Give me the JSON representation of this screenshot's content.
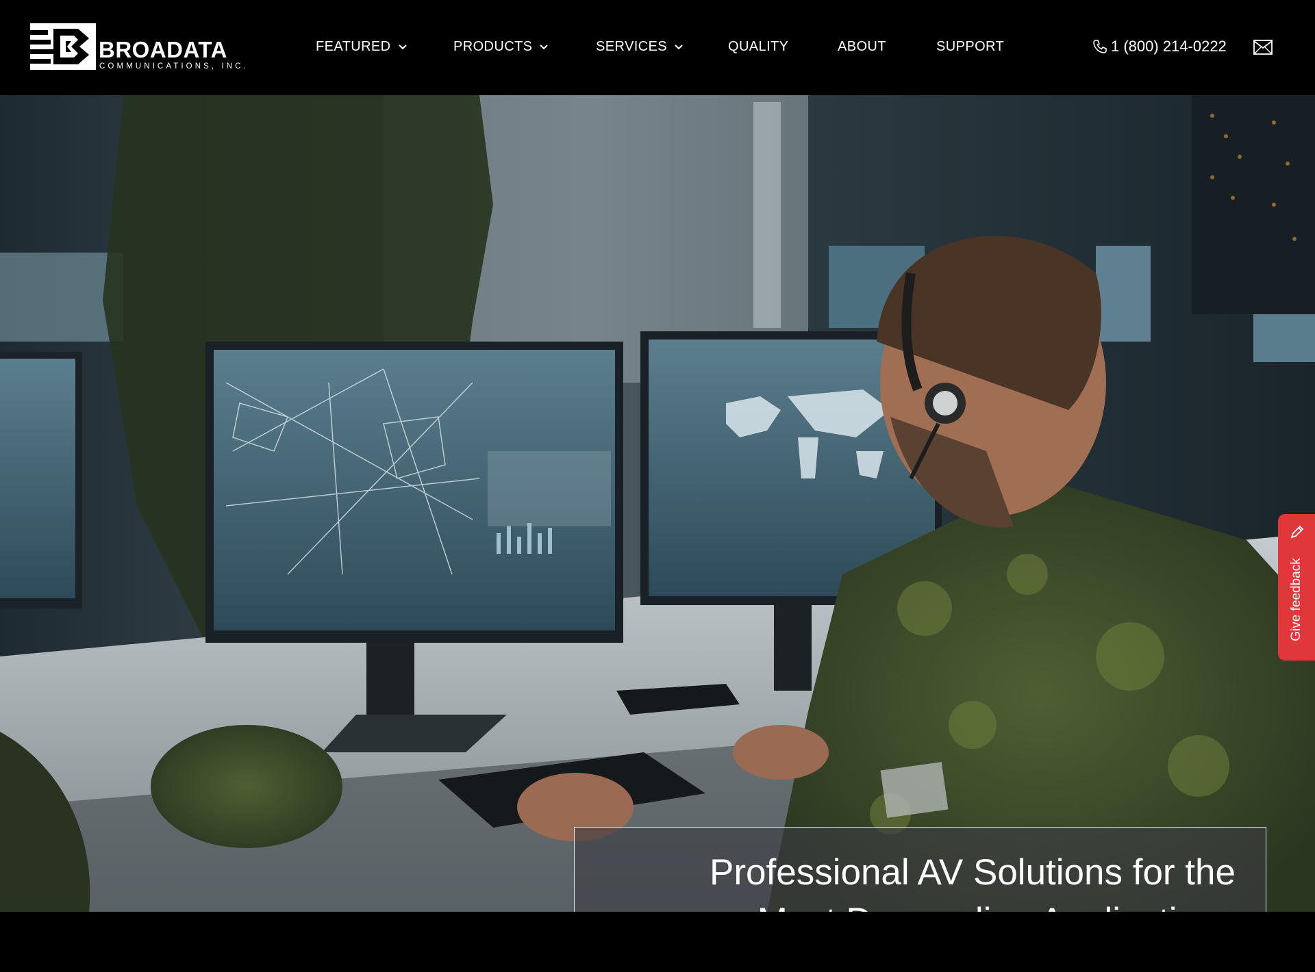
{
  "brand": {
    "name": "BROADATA",
    "subtitle": "COMMUNICATIONS, INC."
  },
  "nav": {
    "items": [
      {
        "label": "FEATURED",
        "has_dropdown": true
      },
      {
        "label": "PRODUCTS",
        "has_dropdown": true
      },
      {
        "label": "SERVICES",
        "has_dropdown": true
      },
      {
        "label": "QUALITY",
        "has_dropdown": false
      },
      {
        "label": "ABOUT",
        "has_dropdown": false
      },
      {
        "label": "SUPPORT",
        "has_dropdown": false
      }
    ]
  },
  "contact": {
    "phone": "1 (800) 214-0222",
    "phone_icon": "phone-icon",
    "mail_icon": "envelope-icon"
  },
  "hero": {
    "headline_line1": "Professional AV Solutions for the",
    "headline_line2": "Most Demanding Applications"
  },
  "feedback": {
    "label": "Give feedback",
    "icon": "pencil-icon",
    "color": "#e0383a"
  },
  "colors": {
    "header_bg": "#000000",
    "hero_tint": "#1c2830"
  }
}
